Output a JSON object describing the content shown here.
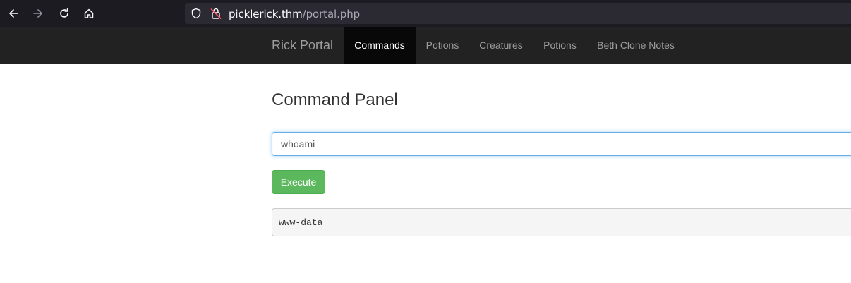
{
  "browser": {
    "url_host": "picklerick.thm",
    "url_path": "/portal.php"
  },
  "navbar": {
    "brand": "Rick Portal",
    "items": [
      {
        "label": "Commands",
        "active": true
      },
      {
        "label": "Potions",
        "active": false
      },
      {
        "label": "Creatures",
        "active": false
      },
      {
        "label": "Potions",
        "active": false
      },
      {
        "label": "Beth Clone Notes",
        "active": false
      }
    ]
  },
  "main": {
    "title": "Command Panel",
    "command_value": "whoami",
    "execute_label": "Execute",
    "output": "www-data"
  },
  "colors": {
    "navbar_bg": "#222222",
    "active_nav_bg": "#080808",
    "button_green": "#5cb85c",
    "input_focus": "#66afe9"
  }
}
